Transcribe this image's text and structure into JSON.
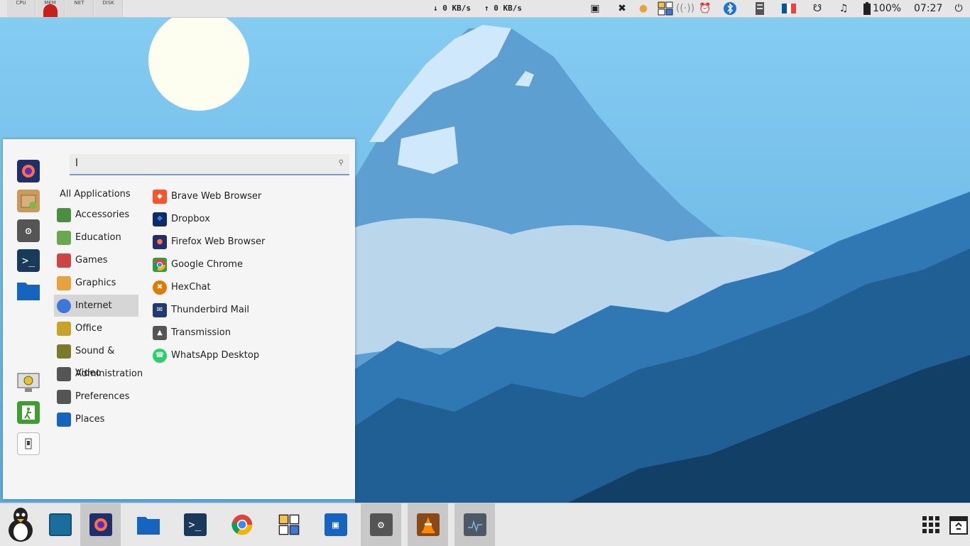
{
  "top_panel": {
    "monitors": [
      {
        "label": "CPU"
      },
      {
        "label": "MEM"
      },
      {
        "label": "NET"
      },
      {
        "label": "DISK"
      }
    ],
    "net_down": "↓ 0 KB/s",
    "net_up": "↑ 0 KB/s",
    "battery": "100%",
    "clock": "07:27"
  },
  "menu": {
    "search": {
      "value": "l",
      "placeholder": ""
    },
    "all_apps_label": "All Applications",
    "categories": [
      {
        "label": "Accessories",
        "color": "#4a8f3f"
      },
      {
        "label": "Education",
        "color": "#6aa84f"
      },
      {
        "label": "Games",
        "color": "#cc4444"
      },
      {
        "label": "Graphics",
        "color": "#e6a23c"
      },
      {
        "label": "Internet",
        "color": "#3c78d8"
      },
      {
        "label": "Office",
        "color": "#c9a227"
      },
      {
        "label": "Sound & Video",
        "color": "#7a7a2a"
      },
      {
        "label": "Administration",
        "color": "#555555"
      },
      {
        "label": "Preferences",
        "color": "#555555"
      },
      {
        "label": "Places",
        "color": "#1565c0"
      }
    ],
    "selected_category": "Internet",
    "apps": [
      {
        "label": "Brave Web Browser",
        "color": "#fb542b"
      },
      {
        "label": "Dropbox",
        "color": "#0d2b6b"
      },
      {
        "label": "Firefox Web Browser",
        "color": "#1f2f6e"
      },
      {
        "label": "Google Chrome",
        "color": "#2e9e44"
      },
      {
        "label": "HexChat",
        "color": "#e07b00"
      },
      {
        "label": "Thunderbird Mail",
        "color": "#1f3b73"
      },
      {
        "label": "Transmission",
        "color": "#555555"
      },
      {
        "label": "WhatsApp Desktop",
        "color": "#25d366"
      }
    ]
  }
}
